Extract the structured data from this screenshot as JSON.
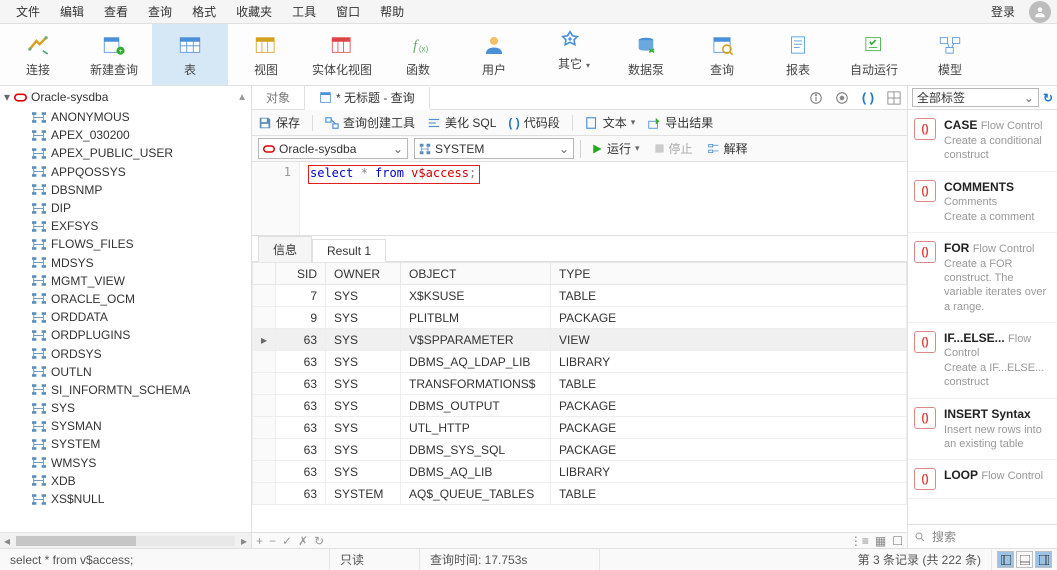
{
  "menu": [
    "文件",
    "编辑",
    "查看",
    "查询",
    "格式",
    "收藏夹",
    "工具",
    "窗口",
    "帮助"
  ],
  "login": "登录",
  "toolbar": [
    {
      "id": "connect",
      "label": "连接"
    },
    {
      "id": "newquery",
      "label": "新建查询"
    },
    {
      "id": "table",
      "label": "表",
      "active": true
    },
    {
      "id": "view",
      "label": "视图"
    },
    {
      "id": "matview",
      "label": "实体化视图"
    },
    {
      "id": "func",
      "label": "函数"
    },
    {
      "id": "user",
      "label": "用户"
    },
    {
      "id": "other",
      "label": "其它"
    },
    {
      "id": "datapump",
      "label": "数据泵"
    },
    {
      "id": "query",
      "label": "查询"
    },
    {
      "id": "report",
      "label": "报表"
    },
    {
      "id": "autorun",
      "label": "自动运行"
    },
    {
      "id": "model",
      "label": "模型"
    }
  ],
  "sidebar": {
    "connection": "Oracle-sysdba",
    "schemas": [
      "ANONYMOUS",
      "APEX_030200",
      "APEX_PUBLIC_USER",
      "APPQOSSYS",
      "DBSNMP",
      "DIP",
      "EXFSYS",
      "FLOWS_FILES",
      "MDSYS",
      "MGMT_VIEW",
      "ORACLE_OCM",
      "ORDDATA",
      "ORDPLUGINS",
      "ORDSYS",
      "OUTLN",
      "SI_INFORMTN_SCHEMA",
      "SYS",
      "SYSMAN",
      "SYSTEM",
      "WMSYS",
      "XDB",
      "XS$NULL"
    ]
  },
  "tabs": {
    "objects": "对象",
    "query": "* 无标题 - 查询"
  },
  "querybar": {
    "save": "保存",
    "builder": "查询创建工具",
    "beautify": "美化 SQL",
    "snippet": "代码段",
    "text": "文本",
    "export": "导出结果"
  },
  "connbar": {
    "conn": "Oracle-sysdba",
    "schema": "SYSTEM",
    "run": "运行",
    "stop": "停止",
    "explain": "解释"
  },
  "editor": {
    "line": "1",
    "sql_select": "select",
    "sql_mid": " * ",
    "sql_from": "from",
    "sql_tbl": " v$access",
    "sql_semi": ";"
  },
  "restabs": {
    "info": "信息",
    "result": "Result 1"
  },
  "grid": {
    "headers": [
      "SID",
      "OWNER",
      "OBJECT",
      "TYPE"
    ],
    "rows": [
      {
        "sid": "7",
        "owner": "SYS",
        "object": "X$KSUSE",
        "type": "TABLE"
      },
      {
        "sid": "9",
        "owner": "SYS",
        "object": "PLITBLM",
        "type": "PACKAGE"
      },
      {
        "sid": "63",
        "owner": "SYS",
        "object": "V$SPPARAMETER",
        "type": "VIEW",
        "sel": true
      },
      {
        "sid": "63",
        "owner": "SYS",
        "object": "DBMS_AQ_LDAP_LIB",
        "type": "LIBRARY"
      },
      {
        "sid": "63",
        "owner": "SYS",
        "object": "TRANSFORMATIONS$",
        "type": "TABLE"
      },
      {
        "sid": "63",
        "owner": "SYS",
        "object": "DBMS_OUTPUT",
        "type": "PACKAGE"
      },
      {
        "sid": "63",
        "owner": "SYS",
        "object": "UTL_HTTP",
        "type": "PACKAGE"
      },
      {
        "sid": "63",
        "owner": "SYS",
        "object": "DBMS_SYS_SQL",
        "type": "PACKAGE"
      },
      {
        "sid": "63",
        "owner": "SYS",
        "object": "DBMS_AQ_LIB",
        "type": "LIBRARY"
      },
      {
        "sid": "63",
        "owner": "SYSTEM",
        "object": "AQ$_QUEUE_TABLES",
        "type": "TABLE"
      }
    ]
  },
  "snippets": {
    "filter": "全部标签",
    "items": [
      {
        "title": "CASE",
        "cat": "Flow Control",
        "desc": "Create a conditional construct"
      },
      {
        "title": "COMMENTS",
        "cat": "Comments",
        "desc": "Create a comment"
      },
      {
        "title": "FOR",
        "cat": "Flow Control",
        "desc": "Create a FOR construct. The variable iterates over a range."
      },
      {
        "title": "IF...ELSE...",
        "cat": "Flow Control",
        "desc": "Create a IF...ELSE... construct"
      },
      {
        "title": "INSERT Syntax",
        "cat": "",
        "desc": "Insert new rows into an existing table"
      },
      {
        "title": "LOOP",
        "cat": "Flow Control",
        "desc": ""
      }
    ],
    "search": "搜索"
  },
  "status": {
    "sql": "select * from v$access;",
    "readonly": "只读",
    "time": "查询时间: 17.753s",
    "records": "第 3 条记录 (共 222 条)"
  }
}
